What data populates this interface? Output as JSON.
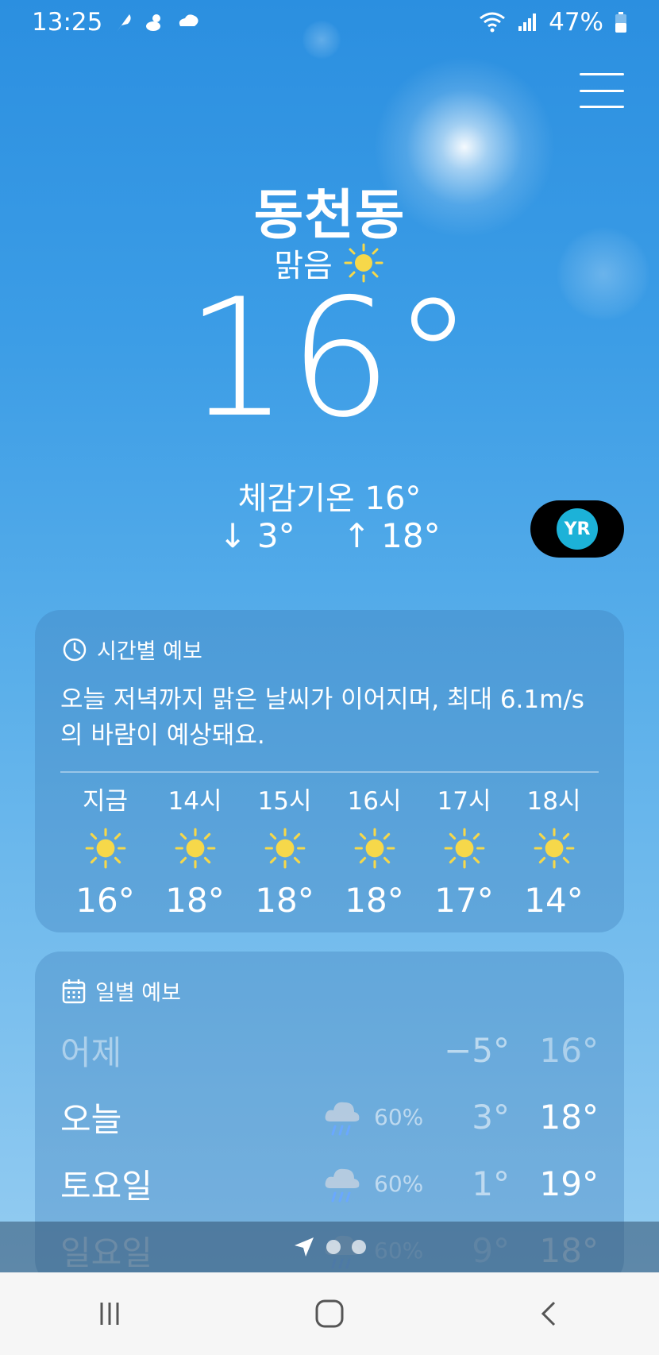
{
  "status_bar": {
    "time": "13:25",
    "battery": "47%",
    "icons": [
      "feather-icon",
      "bird-icon",
      "cloud-swirl-icon",
      "wifi-icon",
      "signal-icon",
      "battery-icon"
    ]
  },
  "location": "동천동",
  "condition": "맑음",
  "current_temp": "16°",
  "feels_like": "체감기온 16°",
  "low": "↓ 3°",
  "high": "↑ 18°",
  "provider_badge": "YR",
  "hourly": {
    "header": "시간별 예보",
    "summary": "오늘 저녁까지 맑은 날씨가 이어지며, 최대 6.1m/s 의 바람이 예상돼요.",
    "items": [
      {
        "time": "지금",
        "icon": "sun-icon",
        "temp": "16°"
      },
      {
        "time": "14시",
        "icon": "sun-icon",
        "temp": "18°"
      },
      {
        "time": "15시",
        "icon": "sun-icon",
        "temp": "18°"
      },
      {
        "time": "16시",
        "icon": "sun-icon",
        "temp": "18°"
      },
      {
        "time": "17시",
        "icon": "sun-icon",
        "temp": "17°"
      },
      {
        "time": "18시",
        "icon": "sun-icon",
        "temp": "14°"
      }
    ]
  },
  "daily": {
    "header": "일별 예보",
    "items": [
      {
        "day": "어제",
        "icon": "",
        "pop": "",
        "min": "−5°",
        "max": "16°"
      },
      {
        "day": "오늘",
        "icon": "rain-icon",
        "pop": "60%",
        "min": "3°",
        "max": "18°"
      },
      {
        "day": "토요일",
        "icon": "rain-icon",
        "pop": "60%",
        "min": "1°",
        "max": "19°"
      },
      {
        "day": "일요일",
        "icon": "rain-icon",
        "pop": "60%",
        "min": "9°",
        "max": "18°"
      }
    ]
  },
  "colors": {
    "sky_top": "#2b8fe0",
    "sky_bottom": "#9cd0f2",
    "sun_yellow": "#f6d84a",
    "yr_blue": "#1cb2d8"
  }
}
